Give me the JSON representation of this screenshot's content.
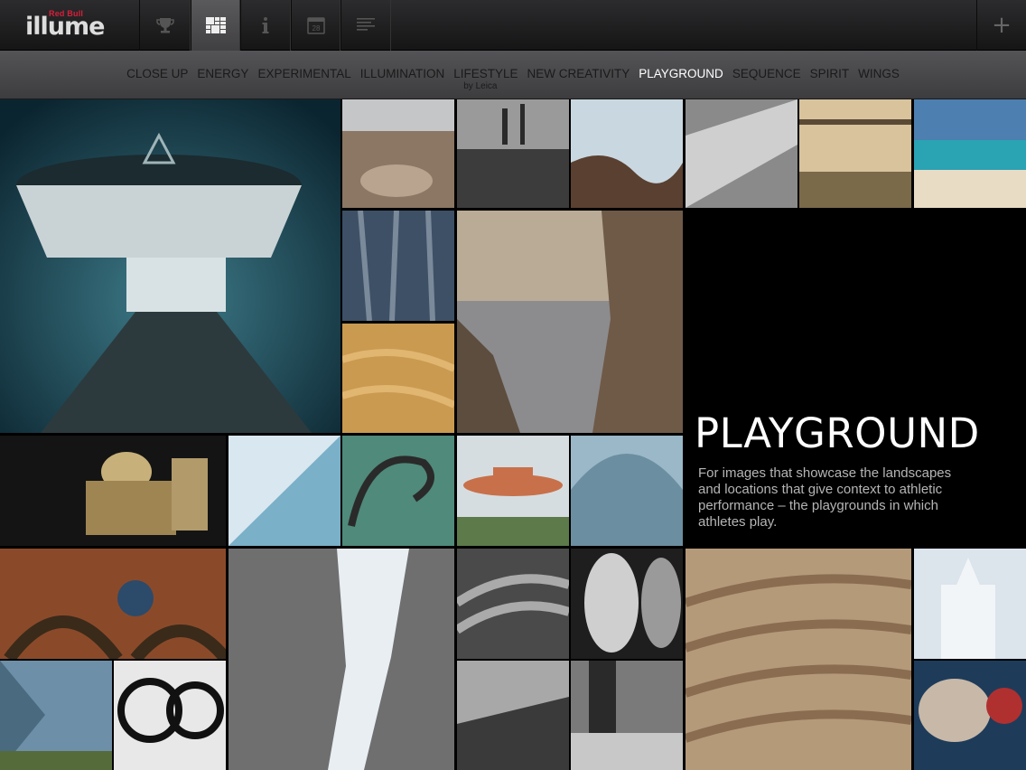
{
  "app": {
    "logo_brand": "Red Bull",
    "logo_name": "illume"
  },
  "toolbar": {
    "buttons": [
      {
        "name": "trophy-icon",
        "active": false
      },
      {
        "name": "grid-icon",
        "active": true
      },
      {
        "name": "info-icon",
        "active": false
      },
      {
        "name": "calendar-icon",
        "active": false
      },
      {
        "name": "list-icon",
        "active": false
      }
    ],
    "calendar_day": "28",
    "add_label": "+"
  },
  "categories": {
    "items": [
      {
        "label": "CLOSE UP"
      },
      {
        "label": "ENERGY"
      },
      {
        "label": "EXPERIMENTAL"
      },
      {
        "label": "ILLUMINATION"
      },
      {
        "label": "LIFESTYLE",
        "sub": "by Leica"
      },
      {
        "label": "NEW CREATIVITY"
      },
      {
        "label": "PLAYGROUND",
        "active": true
      },
      {
        "label": "SEQUENCE"
      },
      {
        "label": "SPIRIT"
      },
      {
        "label": "WINGS"
      }
    ]
  },
  "category_info": {
    "title": "PLAYGROUND",
    "description": "For images that showcase the landscapes and locations that give context to athletic performance – the playgrounds in which athletes play."
  },
  "colors": {
    "topbar": "#1f1e20",
    "catbar": "#4a494b",
    "active_text": "#ffffff",
    "description_text": "#b5b5b5"
  }
}
